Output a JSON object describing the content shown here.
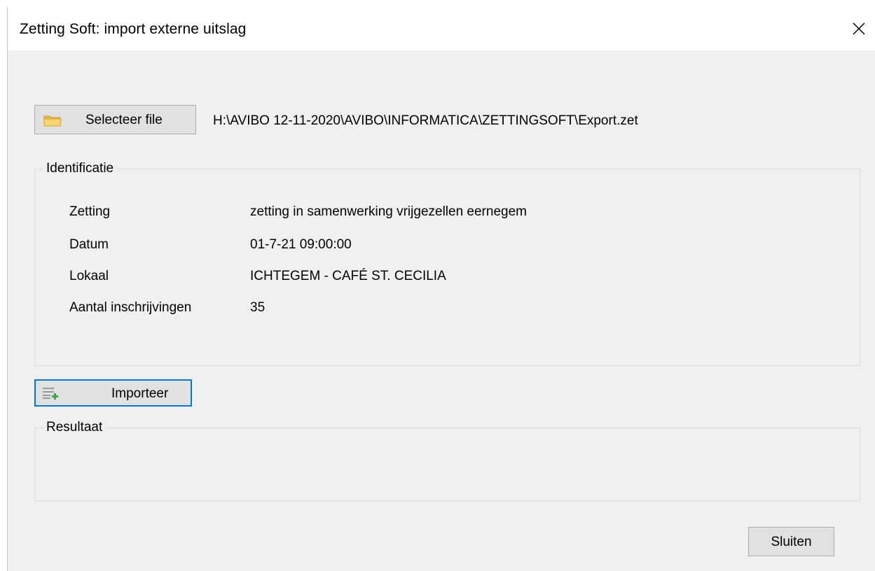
{
  "window": {
    "title": "Zetting Soft: import externe uitslag",
    "close_icon": "close-icon"
  },
  "file": {
    "select_button_label": "Selecteer file",
    "select_button_icon": "folder-icon",
    "path": "H:\\AVIBO 12-11-2020\\AVIBO\\INFORMATICA\\ZETTINGSOFT\\Export.zet"
  },
  "identificatie": {
    "legend": "Identificatie",
    "fields": [
      {
        "label": "Zetting",
        "value": "zetting in samenwerking vrijgezellen eernegem"
      },
      {
        "label": "Datum",
        "value": "01-7-21 09:00:00"
      },
      {
        "label": "Lokaal",
        "value": "ICHTEGEM - CAFÉ ST. CECILIA"
      },
      {
        "label": "Aantal inschrijvingen",
        "value": "35"
      }
    ]
  },
  "import": {
    "button_label": "Importeer",
    "button_icon": "list-add-icon"
  },
  "resultaat": {
    "legend": "Resultaat"
  },
  "footer": {
    "close_button_label": "Sluiten"
  },
  "colors": {
    "window_bg": "#f0f0f0",
    "titlebar_bg": "#ffffff",
    "button_bg": "#e1e1e1",
    "focus_border": "#0078d7",
    "groupbox_border": "#dcdcdc"
  }
}
